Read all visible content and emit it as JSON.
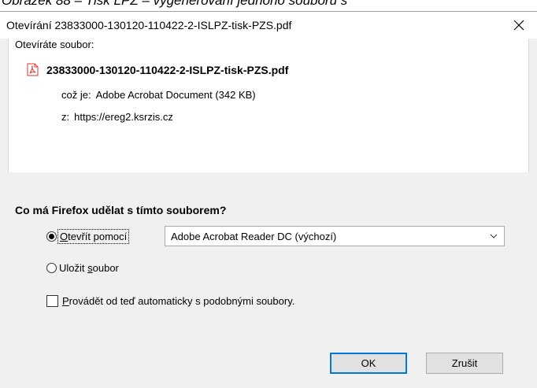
{
  "caption": "Obrázek 88 – Tisk LPZ – vygenerování jednoho souboru s",
  "dialog": {
    "title": "Otevírání 23833000-130120-110422-2-ISLPZ-tisk-PZS.pdf",
    "close_icon": "close-icon"
  },
  "file_info": {
    "opening_label": "Otevíráte soubor:",
    "file_icon": "pdf-file-icon",
    "file_name": "23833000-130120-110422-2-ISLPZ-tisk-PZS.pdf",
    "type_label": "což je:",
    "type_value": "Adobe Acrobat Document (342 KB)",
    "from_label": "z:",
    "from_value": "https://ereg2.ksrzis.cz"
  },
  "question": "Co má Firefox udělat s tímto souborem?",
  "options": {
    "open_with_label_prefix": "O",
    "open_with_label_rest": "tevřít pomocí",
    "open_with_selected": true,
    "app_select_value": "Adobe Acrobat Reader DC (výchozí)",
    "save_label_prefix": "Uložit ",
    "save_label_underlined": "s",
    "save_label_rest": "oubor",
    "save_selected": false,
    "auto_label_underlined": "P",
    "auto_label_rest": "rovádět od teď automaticky s podobnými soubory.",
    "auto_checked": false
  },
  "buttons": {
    "ok_label": "OK",
    "cancel_label": "Zrušit"
  },
  "colors": {
    "dialog_bg": "#f0f0f0",
    "panel_bg": "#ffffff",
    "default_button_border": "#0078d7",
    "pdf_icon_red": "#d9342b"
  }
}
